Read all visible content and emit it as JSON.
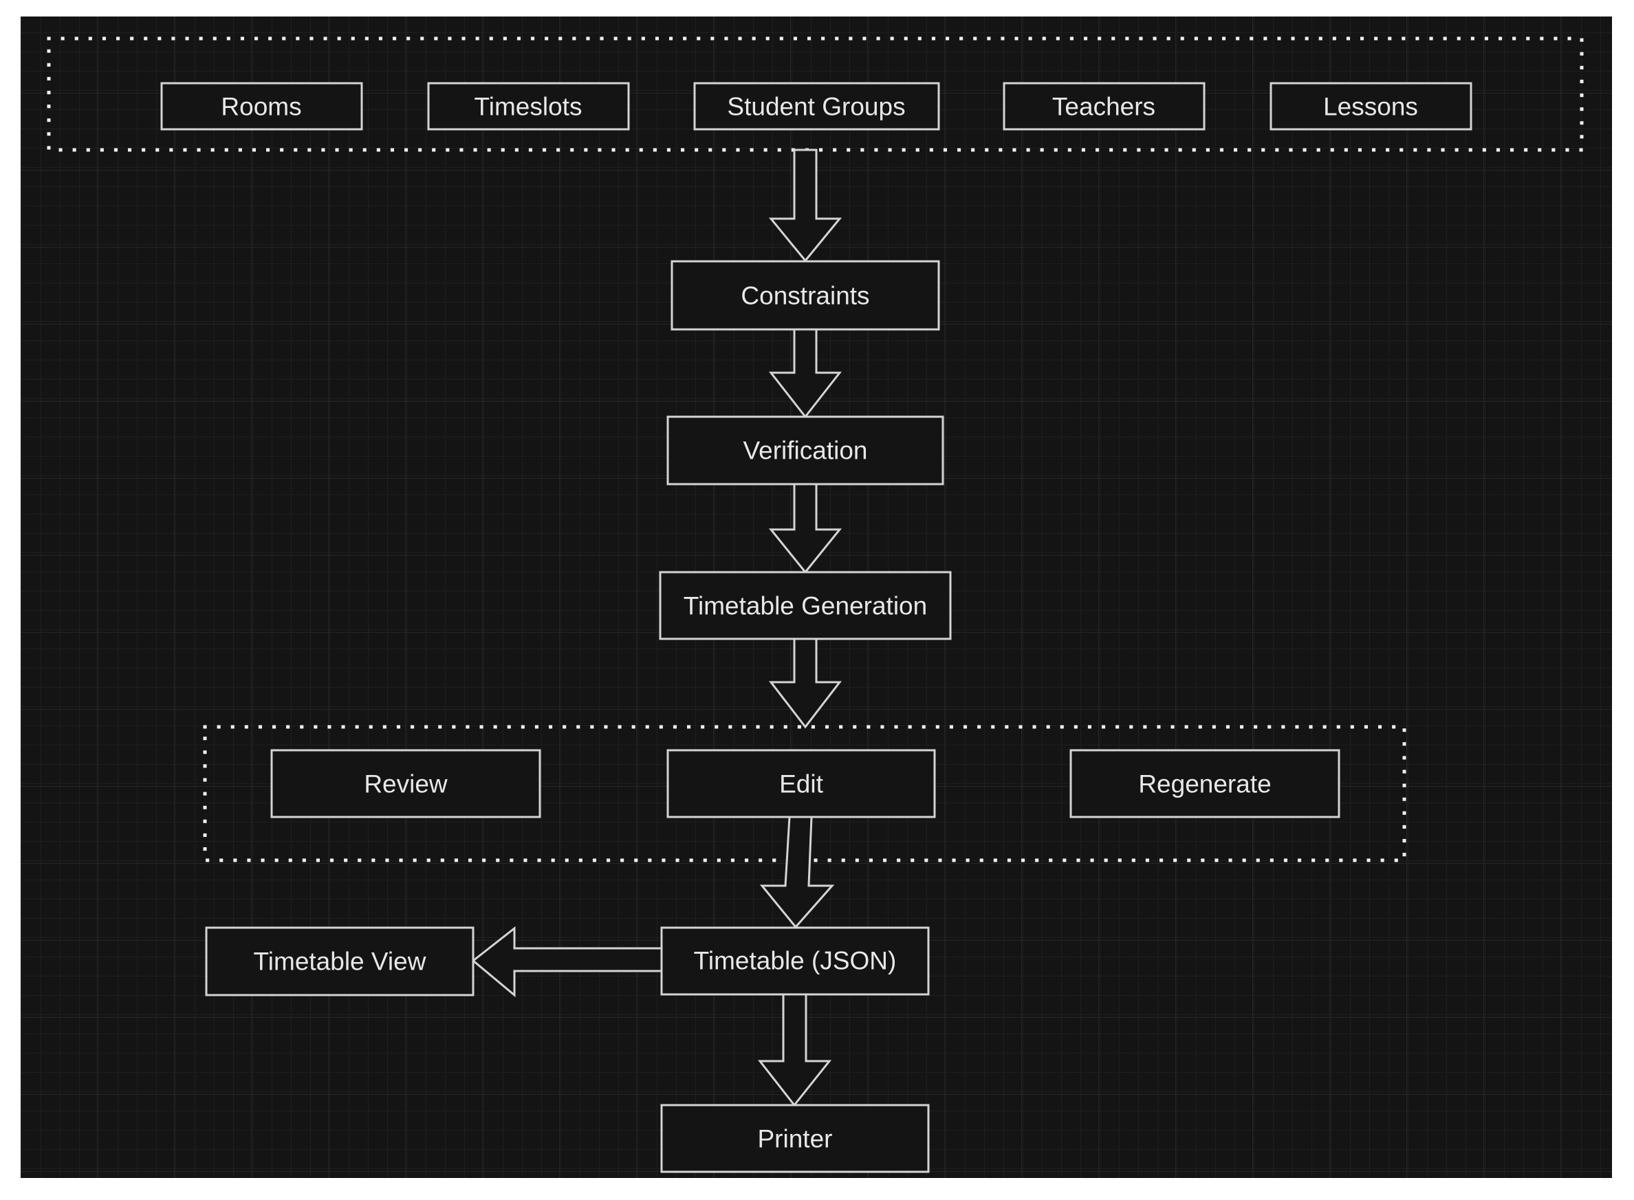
{
  "diagram": {
    "colors": {
      "background": "#141414",
      "grid": "#232323",
      "stroke": "#d4d4d4",
      "text": "#e8e8e8"
    },
    "input_group": {
      "items": [
        "Rooms",
        "Timeslots",
        "Student Groups",
        "Teachers",
        "Lessons"
      ]
    },
    "nodes": {
      "constraints": "Constraints",
      "verification": "Verification",
      "generation": "Timetable Generation",
      "timetable_json": "Timetable (JSON)",
      "timetable_view": "Timetable View",
      "printer": "Printer"
    },
    "action_group": {
      "items": [
        "Review",
        "Edit",
        "Regenerate"
      ]
    },
    "edges": [
      {
        "from": "Input group",
        "to": "Constraints"
      },
      {
        "from": "Constraints",
        "to": "Verification"
      },
      {
        "from": "Verification",
        "to": "Timetable Generation"
      },
      {
        "from": "Timetable Generation",
        "to": "Action group"
      },
      {
        "from": "Edit",
        "to": "Timetable (JSON)"
      },
      {
        "from": "Timetable (JSON)",
        "to": "Timetable View"
      },
      {
        "from": "Timetable (JSON)",
        "to": "Printer"
      }
    ]
  }
}
